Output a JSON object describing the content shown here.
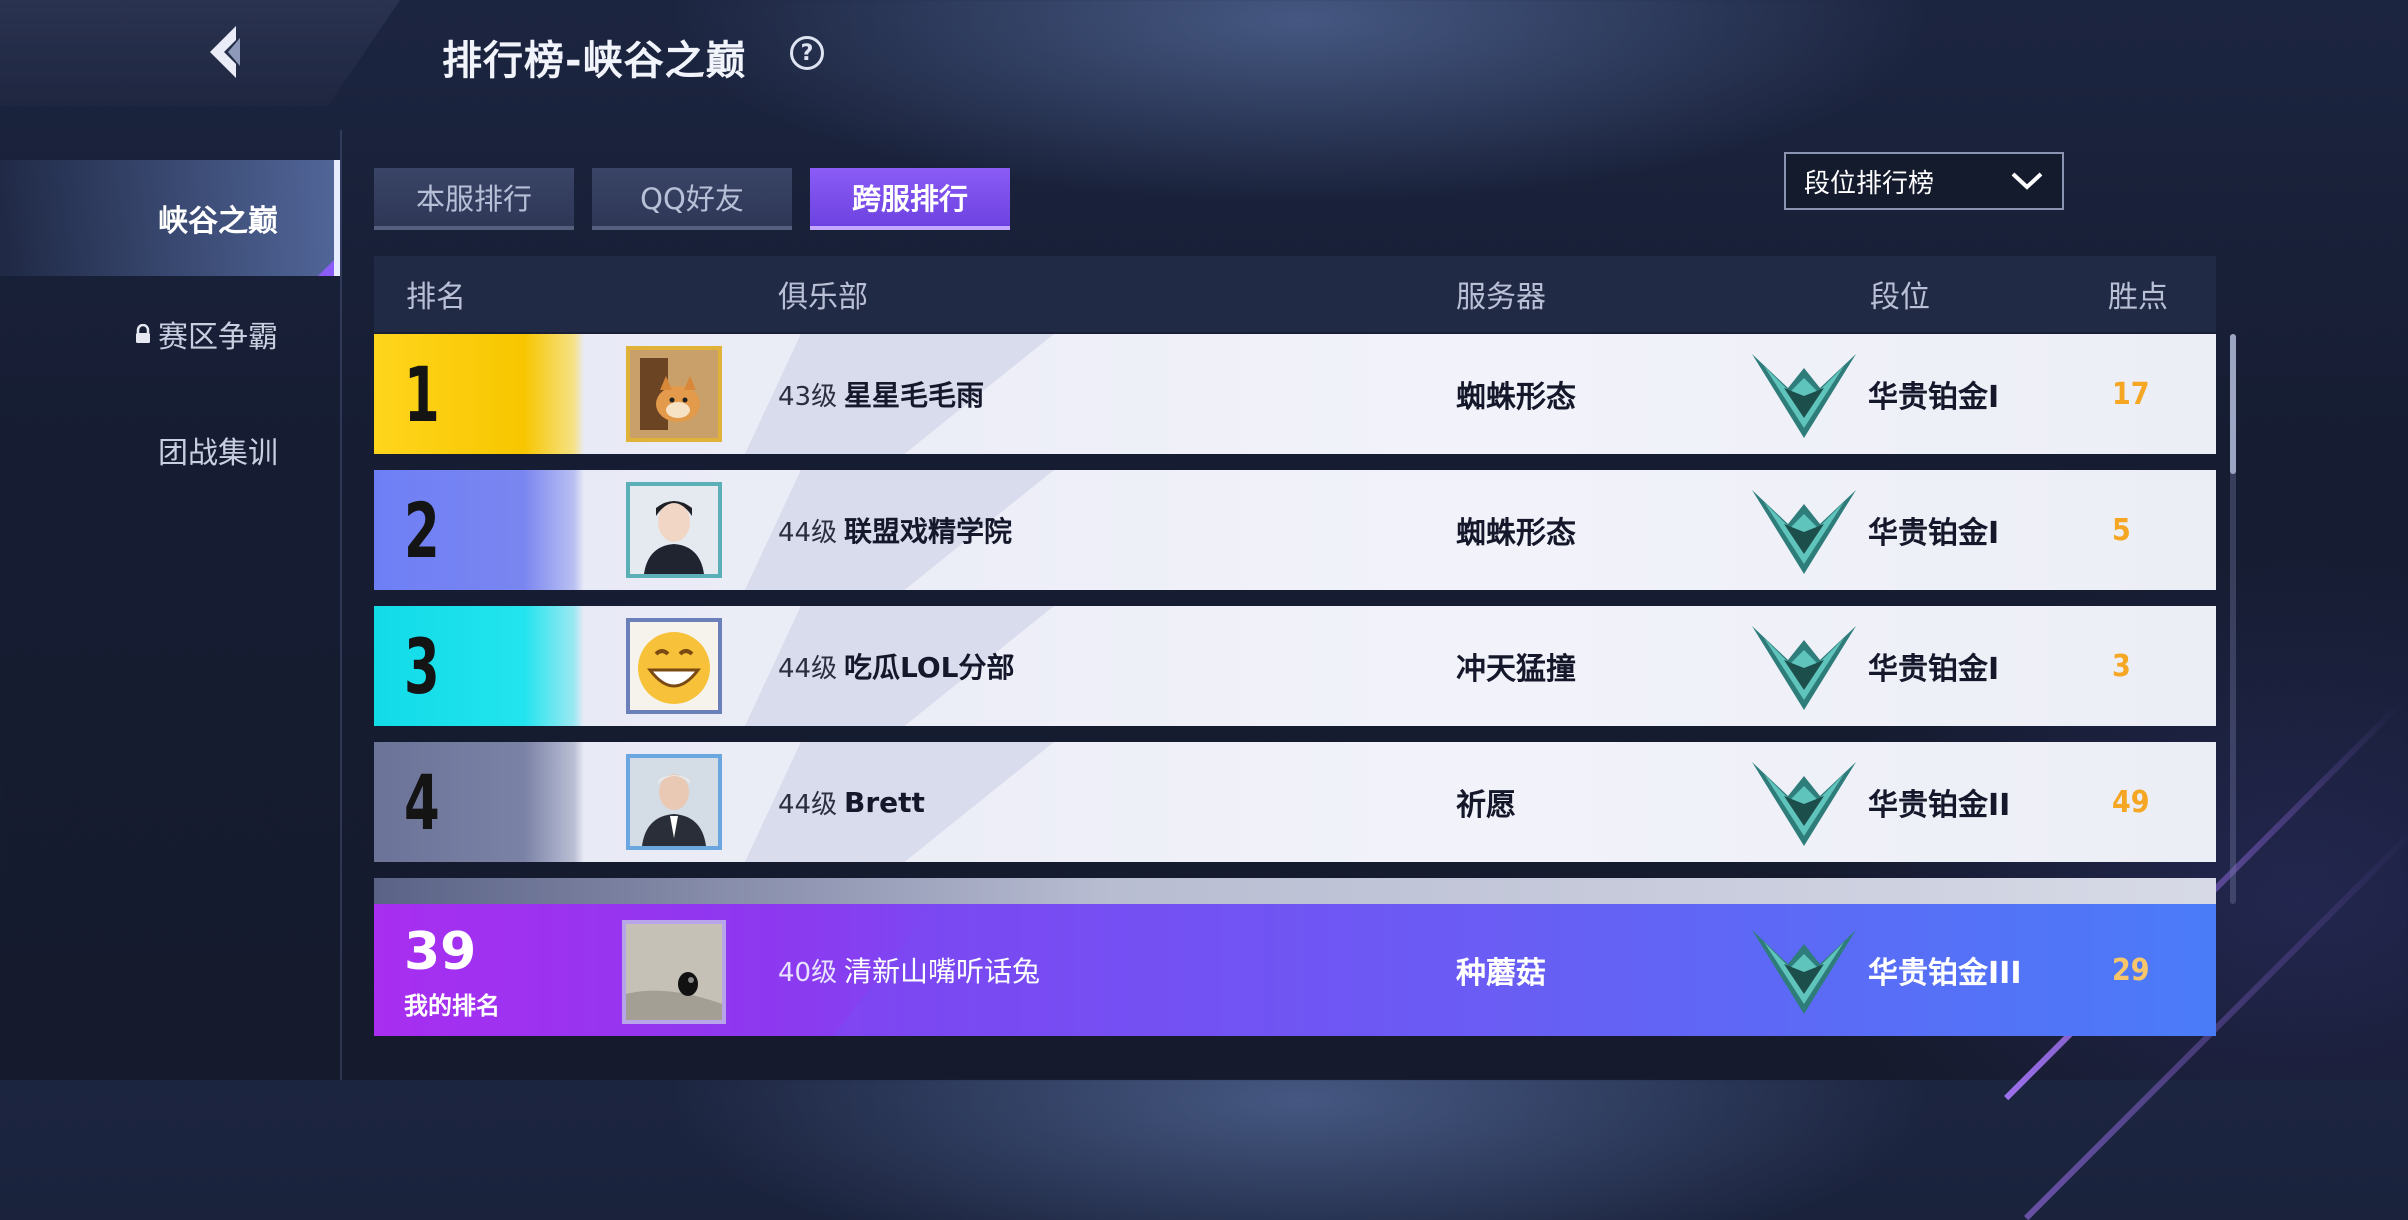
{
  "header": {
    "title": "排行榜-峡谷之巅",
    "help_symbol": "?"
  },
  "sidebar": {
    "items": [
      {
        "label": "峡谷之巅",
        "active": true,
        "locked": false
      },
      {
        "label": "赛区争霸",
        "active": false,
        "locked": true
      },
      {
        "label": "团战集训",
        "active": false,
        "locked": false
      }
    ]
  },
  "tabs": [
    {
      "label": "本服排行",
      "active": false
    },
    {
      "label": "QQ好友",
      "active": false
    },
    {
      "label": "跨服排行",
      "active": true
    }
  ],
  "dropdown": {
    "selected": "段位排行榜"
  },
  "table": {
    "headers": {
      "rank": "排名",
      "club": "俱乐部",
      "server": "服务器",
      "tier": "段位",
      "points": "胜点"
    },
    "rows": [
      {
        "rank": "1",
        "level": "43级",
        "club": "星星毛毛雨",
        "server": "蜘蛛形态",
        "tier": "华贵铂金I",
        "points": "17"
      },
      {
        "rank": "2",
        "level": "44级",
        "club": "联盟戏精学院",
        "server": "蜘蛛形态",
        "tier": "华贵铂金I",
        "points": "5"
      },
      {
        "rank": "3",
        "level": "44级",
        "club": "吃瓜LOL分部",
        "server": "冲天猛撞",
        "tier": "华贵铂金I",
        "points": "3"
      },
      {
        "rank": "4",
        "level": "44级",
        "club": "Brett",
        "server": "祈愿",
        "tier": "华贵铂金II",
        "points": "49"
      }
    ]
  },
  "my_rank": {
    "rank": "39",
    "label": "我的排名",
    "level": "40级",
    "club": "清新山嘴听话兔",
    "server": "种蘑菇",
    "tier": "华贵铂金III",
    "points": "29"
  },
  "colors": {
    "accent": "#8b5cf6",
    "gold": "#ffd21a",
    "points": "#f5a623"
  }
}
